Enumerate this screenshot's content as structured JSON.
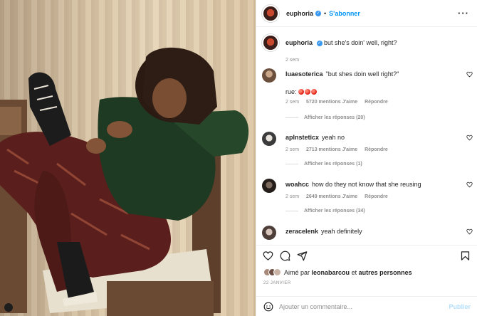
{
  "post": {
    "account": "euphoria",
    "verified_mark": "✓",
    "separator": "•",
    "follow_label": "S'abonner",
    "more_label": "···"
  },
  "caption": {
    "username": "euphoria",
    "text": "but she's doin' well, right?",
    "time": "2 sem"
  },
  "comments": [
    {
      "username": "luaesoterica",
      "text": "\"but shes doin well right?\"",
      "extra_text": "rue:",
      "extra_emoji_count": 3,
      "time": "2 sem",
      "likes": "5720 mentions J'aime",
      "reply_label": "Répondre",
      "view_replies": "Afficher les réponses (20)",
      "avatar_color": "#8a6a52"
    },
    {
      "username": "aplnsteticx",
      "text": "yeah no",
      "time": "2 sem",
      "likes": "2713 mentions J'aime",
      "reply_label": "Répondre",
      "view_replies": "Afficher les réponses (1)",
      "avatar_color": "#5b5b5b"
    },
    {
      "username": "woahcc",
      "text": "how do they not know that she reusing",
      "time": "2 sem",
      "likes": "2649 mentions J'aime",
      "reply_label": "Répondre",
      "view_replies": "Afficher les réponses (34)",
      "avatar_color": "#3a2f2a"
    },
    {
      "username": "zeracelenk",
      "text": "yeah definitely",
      "avatar_color": "#6e5a55"
    }
  ],
  "likes": {
    "prefix": "Aimé par",
    "user": "leonabarcou",
    "suffix": "et",
    "others": "autres personnes"
  },
  "date": "22 JANVIER",
  "add_comment": {
    "placeholder": "Ajouter un commentaire...",
    "publish_label": "Publier"
  },
  "icons": [
    "heart-icon",
    "comment-icon",
    "share-icon",
    "bookmark-icon",
    "emoji-icon",
    "more-icon"
  ],
  "colors": {
    "accent": "#0095f6",
    "text": "#262626",
    "muted": "#8e8e8e",
    "publish_disabled": "#b2dffc"
  }
}
